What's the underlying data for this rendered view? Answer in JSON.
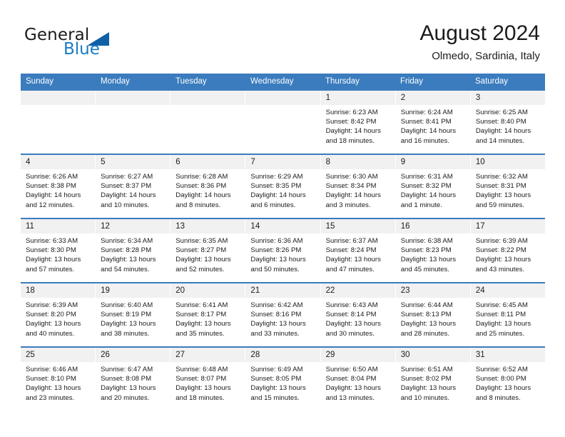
{
  "brand": {
    "name_part1": "General",
    "name_part2": "Blue",
    "accent_color": "#1a7bc4",
    "triangle_color": "#1060a8"
  },
  "header": {
    "month_title": "August 2024",
    "location": "Olmedo, Sardinia, Italy"
  },
  "calendar": {
    "header_color": "#3a7cbe",
    "daynum_band_color": "#f1f1f1",
    "weekdays": [
      "Sunday",
      "Monday",
      "Tuesday",
      "Wednesday",
      "Thursday",
      "Friday",
      "Saturday"
    ],
    "labels": {
      "sunrise": "Sunrise:",
      "sunset": "Sunset:",
      "daylight": "Daylight:"
    },
    "weeks": [
      [
        {
          "empty": true
        },
        {
          "empty": true
        },
        {
          "empty": true
        },
        {
          "empty": true
        },
        {
          "day": "1",
          "sunrise": "Sunrise: 6:23 AM",
          "sunset": "Sunset: 8:42 PM",
          "daylight_l1": "Daylight: 14 hours",
          "daylight_l2": "and 18 minutes."
        },
        {
          "day": "2",
          "sunrise": "Sunrise: 6:24 AM",
          "sunset": "Sunset: 8:41 PM",
          "daylight_l1": "Daylight: 14 hours",
          "daylight_l2": "and 16 minutes."
        },
        {
          "day": "3",
          "sunrise": "Sunrise: 6:25 AM",
          "sunset": "Sunset: 8:40 PM",
          "daylight_l1": "Daylight: 14 hours",
          "daylight_l2": "and 14 minutes."
        }
      ],
      [
        {
          "day": "4",
          "sunrise": "Sunrise: 6:26 AM",
          "sunset": "Sunset: 8:38 PM",
          "daylight_l1": "Daylight: 14 hours",
          "daylight_l2": "and 12 minutes."
        },
        {
          "day": "5",
          "sunrise": "Sunrise: 6:27 AM",
          "sunset": "Sunset: 8:37 PM",
          "daylight_l1": "Daylight: 14 hours",
          "daylight_l2": "and 10 minutes."
        },
        {
          "day": "6",
          "sunrise": "Sunrise: 6:28 AM",
          "sunset": "Sunset: 8:36 PM",
          "daylight_l1": "Daylight: 14 hours",
          "daylight_l2": "and 8 minutes."
        },
        {
          "day": "7",
          "sunrise": "Sunrise: 6:29 AM",
          "sunset": "Sunset: 8:35 PM",
          "daylight_l1": "Daylight: 14 hours",
          "daylight_l2": "and 6 minutes."
        },
        {
          "day": "8",
          "sunrise": "Sunrise: 6:30 AM",
          "sunset": "Sunset: 8:34 PM",
          "daylight_l1": "Daylight: 14 hours",
          "daylight_l2": "and 3 minutes."
        },
        {
          "day": "9",
          "sunrise": "Sunrise: 6:31 AM",
          "sunset": "Sunset: 8:32 PM",
          "daylight_l1": "Daylight: 14 hours",
          "daylight_l2": "and 1 minute."
        },
        {
          "day": "10",
          "sunrise": "Sunrise: 6:32 AM",
          "sunset": "Sunset: 8:31 PM",
          "daylight_l1": "Daylight: 13 hours",
          "daylight_l2": "and 59 minutes."
        }
      ],
      [
        {
          "day": "11",
          "sunrise": "Sunrise: 6:33 AM",
          "sunset": "Sunset: 8:30 PM",
          "daylight_l1": "Daylight: 13 hours",
          "daylight_l2": "and 57 minutes."
        },
        {
          "day": "12",
          "sunrise": "Sunrise: 6:34 AM",
          "sunset": "Sunset: 8:28 PM",
          "daylight_l1": "Daylight: 13 hours",
          "daylight_l2": "and 54 minutes."
        },
        {
          "day": "13",
          "sunrise": "Sunrise: 6:35 AM",
          "sunset": "Sunset: 8:27 PM",
          "daylight_l1": "Daylight: 13 hours",
          "daylight_l2": "and 52 minutes."
        },
        {
          "day": "14",
          "sunrise": "Sunrise: 6:36 AM",
          "sunset": "Sunset: 8:26 PM",
          "daylight_l1": "Daylight: 13 hours",
          "daylight_l2": "and 50 minutes."
        },
        {
          "day": "15",
          "sunrise": "Sunrise: 6:37 AM",
          "sunset": "Sunset: 8:24 PM",
          "daylight_l1": "Daylight: 13 hours",
          "daylight_l2": "and 47 minutes."
        },
        {
          "day": "16",
          "sunrise": "Sunrise: 6:38 AM",
          "sunset": "Sunset: 8:23 PM",
          "daylight_l1": "Daylight: 13 hours",
          "daylight_l2": "and 45 minutes."
        },
        {
          "day": "17",
          "sunrise": "Sunrise: 6:39 AM",
          "sunset": "Sunset: 8:22 PM",
          "daylight_l1": "Daylight: 13 hours",
          "daylight_l2": "and 43 minutes."
        }
      ],
      [
        {
          "day": "18",
          "sunrise": "Sunrise: 6:39 AM",
          "sunset": "Sunset: 8:20 PM",
          "daylight_l1": "Daylight: 13 hours",
          "daylight_l2": "and 40 minutes."
        },
        {
          "day": "19",
          "sunrise": "Sunrise: 6:40 AM",
          "sunset": "Sunset: 8:19 PM",
          "daylight_l1": "Daylight: 13 hours",
          "daylight_l2": "and 38 minutes."
        },
        {
          "day": "20",
          "sunrise": "Sunrise: 6:41 AM",
          "sunset": "Sunset: 8:17 PM",
          "daylight_l1": "Daylight: 13 hours",
          "daylight_l2": "and 35 minutes."
        },
        {
          "day": "21",
          "sunrise": "Sunrise: 6:42 AM",
          "sunset": "Sunset: 8:16 PM",
          "daylight_l1": "Daylight: 13 hours",
          "daylight_l2": "and 33 minutes."
        },
        {
          "day": "22",
          "sunrise": "Sunrise: 6:43 AM",
          "sunset": "Sunset: 8:14 PM",
          "daylight_l1": "Daylight: 13 hours",
          "daylight_l2": "and 30 minutes."
        },
        {
          "day": "23",
          "sunrise": "Sunrise: 6:44 AM",
          "sunset": "Sunset: 8:13 PM",
          "daylight_l1": "Daylight: 13 hours",
          "daylight_l2": "and 28 minutes."
        },
        {
          "day": "24",
          "sunrise": "Sunrise: 6:45 AM",
          "sunset": "Sunset: 8:11 PM",
          "daylight_l1": "Daylight: 13 hours",
          "daylight_l2": "and 25 minutes."
        }
      ],
      [
        {
          "day": "25",
          "sunrise": "Sunrise: 6:46 AM",
          "sunset": "Sunset: 8:10 PM",
          "daylight_l1": "Daylight: 13 hours",
          "daylight_l2": "and 23 minutes."
        },
        {
          "day": "26",
          "sunrise": "Sunrise: 6:47 AM",
          "sunset": "Sunset: 8:08 PM",
          "daylight_l1": "Daylight: 13 hours",
          "daylight_l2": "and 20 minutes."
        },
        {
          "day": "27",
          "sunrise": "Sunrise: 6:48 AM",
          "sunset": "Sunset: 8:07 PM",
          "daylight_l1": "Daylight: 13 hours",
          "daylight_l2": "and 18 minutes."
        },
        {
          "day": "28",
          "sunrise": "Sunrise: 6:49 AM",
          "sunset": "Sunset: 8:05 PM",
          "daylight_l1": "Daylight: 13 hours",
          "daylight_l2": "and 15 minutes."
        },
        {
          "day": "29",
          "sunrise": "Sunrise: 6:50 AM",
          "sunset": "Sunset: 8:04 PM",
          "daylight_l1": "Daylight: 13 hours",
          "daylight_l2": "and 13 minutes."
        },
        {
          "day": "30",
          "sunrise": "Sunrise: 6:51 AM",
          "sunset": "Sunset: 8:02 PM",
          "daylight_l1": "Daylight: 13 hours",
          "daylight_l2": "and 10 minutes."
        },
        {
          "day": "31",
          "sunrise": "Sunrise: 6:52 AM",
          "sunset": "Sunset: 8:00 PM",
          "daylight_l1": "Daylight: 13 hours",
          "daylight_l2": "and 8 minutes."
        }
      ]
    ]
  }
}
